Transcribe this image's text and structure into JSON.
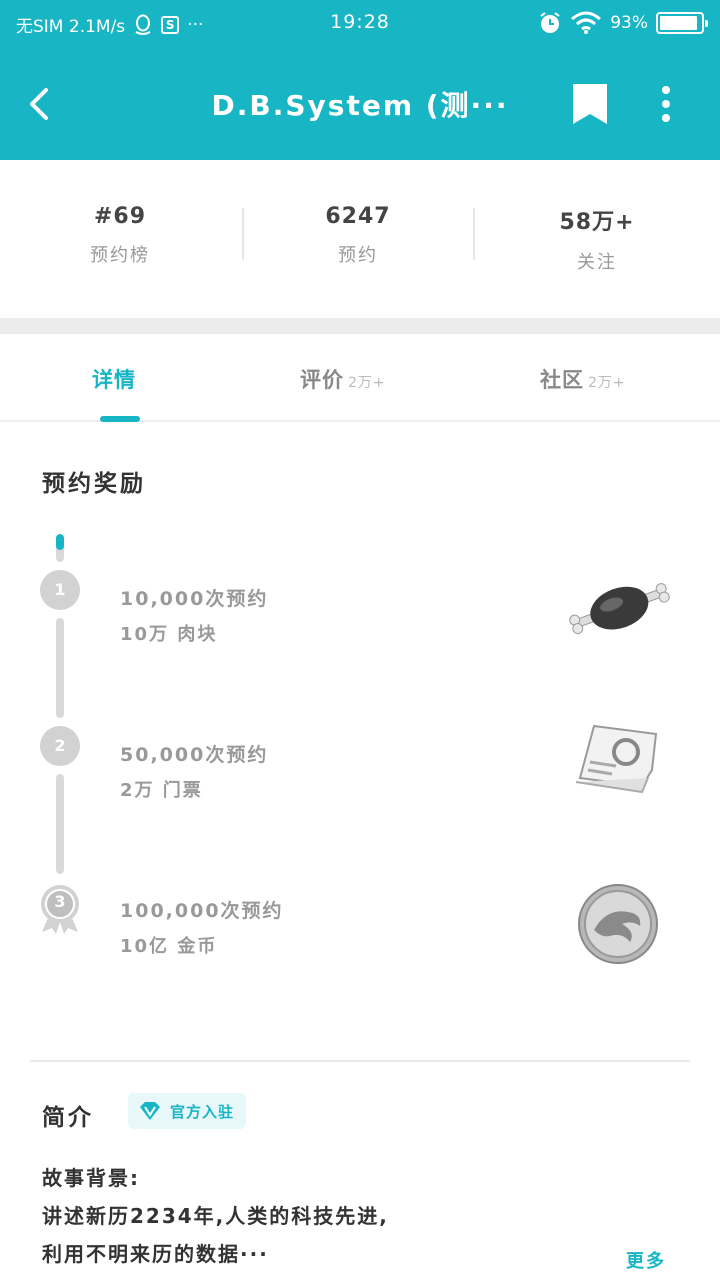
{
  "status_bar": {
    "carrier": "无SIM 2.1M/s",
    "s_label": "S",
    "dots": "···",
    "time": "19:28",
    "battery_percent": "93%",
    "battery_level": 0.93
  },
  "header": {
    "title": "D.B.System (测···"
  },
  "stats": [
    {
      "value": "#69",
      "label": "预约榜"
    },
    {
      "value": "6247",
      "label": "预约"
    },
    {
      "value": "58万+",
      "label": "关注"
    }
  ],
  "tabs": [
    {
      "label": "详情",
      "count": ""
    },
    {
      "label": "评价",
      "count": "2万+"
    },
    {
      "label": "社区",
      "count": "2万+"
    }
  ],
  "rewards": {
    "title": "预约奖励",
    "items": [
      {
        "step": "1",
        "title": "10,000次预约",
        "desc": "10万 肉块",
        "icon": "meat-icon"
      },
      {
        "step": "2",
        "title": "50,000次预约",
        "desc": "2万 门票",
        "icon": "ticket-icon"
      },
      {
        "step": "3",
        "title": "100,000次预约",
        "desc": "10亿 金币",
        "icon": "coin-icon"
      }
    ]
  },
  "intro": {
    "title": "简介",
    "badge": "官方入驻",
    "lines": [
      "故事背景:",
      "讲述新历2234年,人类的科技先进,",
      "利用不明来历的数据···"
    ],
    "more": "更多"
  },
  "colors": {
    "accent": "#18b6c5",
    "muted": "#999999",
    "divider": "#ececec"
  }
}
